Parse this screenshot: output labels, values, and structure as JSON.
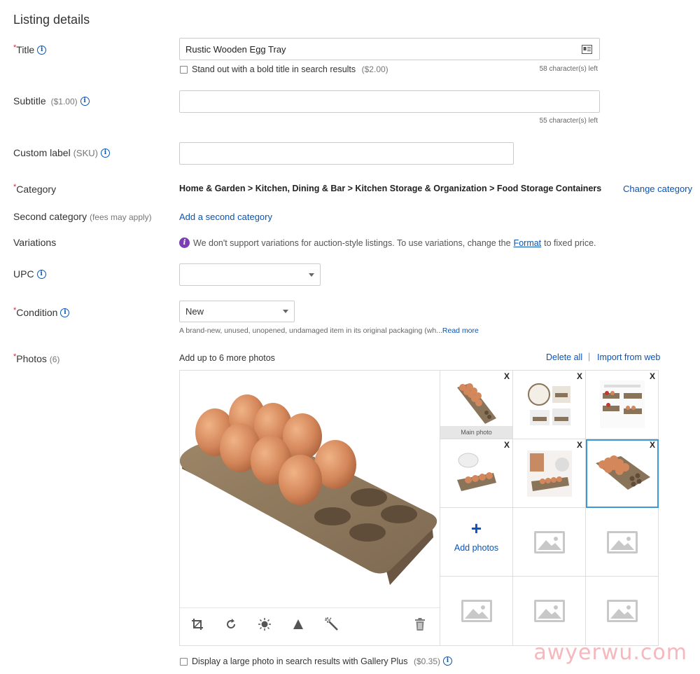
{
  "heading": "Listing details",
  "fields": {
    "title": {
      "label": "Title",
      "value": "Rustic Wooden Egg Tray",
      "bold_option": "Stand out with a bold title in search results",
      "bold_price": "($2.00)",
      "counter": "58 character(s) left"
    },
    "subtitle": {
      "label": "Subtitle",
      "price": "($1.00)",
      "value": "",
      "counter": "55 character(s) left"
    },
    "custom_label": {
      "label": "Custom label",
      "suffix": "(SKU)",
      "value": ""
    },
    "category": {
      "label": "Category",
      "path": "Home & Garden > Kitchen, Dining & Bar > Kitchen Storage & Organization > Food Storage Containers",
      "change_link": "Change category"
    },
    "second_category": {
      "label": "Second category",
      "note": "(fees may apply)",
      "link": "Add a second category"
    },
    "variations": {
      "label": "Variations",
      "message_pre": "We don't support variations for auction-style listings. To use variations, change the",
      "format_link": "Format",
      "message_post": "to fixed price."
    },
    "upc": {
      "label": "UPC",
      "value": ""
    },
    "condition": {
      "label": "Condition",
      "value": "New",
      "description": "A brand-new, unused, unopened, undamaged item in its original packaging (wh...",
      "read_more": "Read more"
    },
    "photos": {
      "label": "Photos",
      "count": "(6)",
      "hint": "Add up to 6 more photos",
      "delete_all": "Delete all",
      "separator": "|",
      "import": "Import from web",
      "main_caption": "Main photo",
      "remove_label": "X",
      "add_plus": "+",
      "add_label": "Add photos",
      "gallery_option": "Display a large photo in search results with Gallery Plus",
      "gallery_price": "($0.35)"
    }
  },
  "required_mark": "*",
  "info_glyph": "i",
  "watermark": "awyerwu.com",
  "colors": {
    "link": "#0654ba",
    "required": "#dd1e31",
    "selected_border": "#3a9ad9",
    "info_purple": "#7b3fb5"
  }
}
